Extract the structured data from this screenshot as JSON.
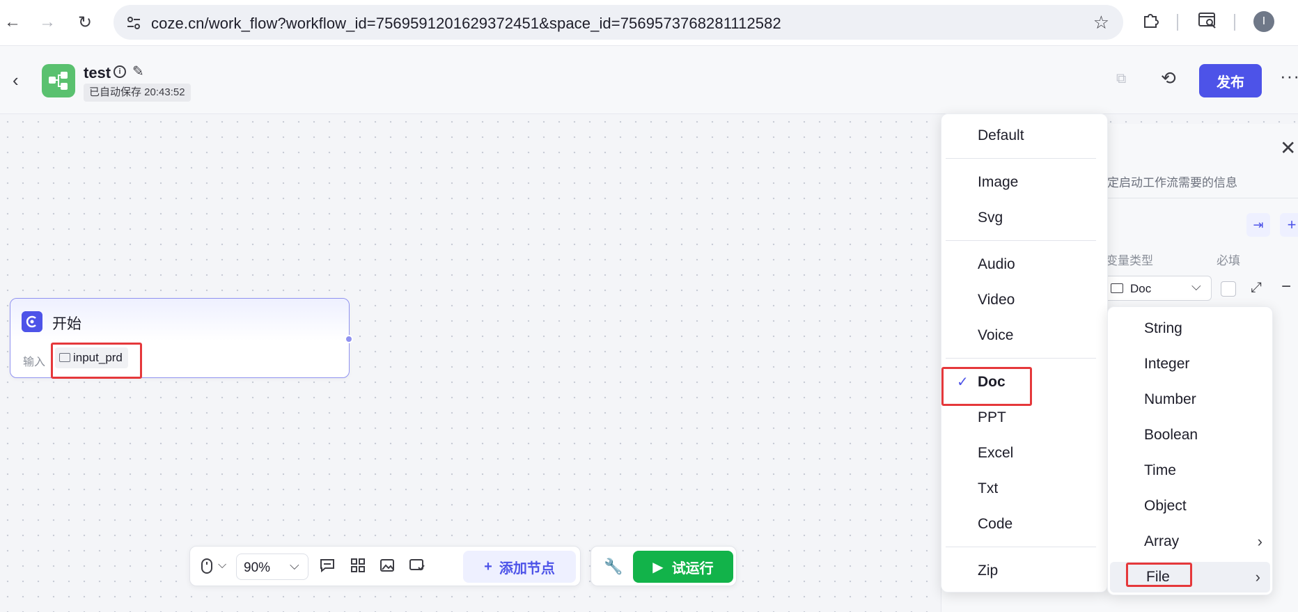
{
  "browser": {
    "url": "coze.cn/work_flow?workflow_id=7569591201629372451&space_id=7569573768281112582",
    "back": "←",
    "forward": "→",
    "reload": "↻",
    "star": "☆",
    "profile_initial": "I",
    "extensions_icon": "puzzle-icon",
    "tab_search_icon": "tab-search-icon"
  },
  "header": {
    "back": "‹",
    "title": "test",
    "autosave": "已自动保存 20:43:52",
    "publish_label": "发布",
    "more": "···"
  },
  "start_node": {
    "title": "开始",
    "input_label": "输入",
    "input_name": "input_prd"
  },
  "toolbar": {
    "zoom": "90%",
    "add_node_label": "添加节点",
    "test_run_label": "试运行"
  },
  "panel": {
    "desc": "定启动工作流需要的信息",
    "col_type": "变量类型",
    "col_required": "必填",
    "type_value": "Doc"
  },
  "file_menu": {
    "items": [
      "Default",
      "Image",
      "Svg",
      "Audio",
      "Video",
      "Voice",
      "Doc",
      "PPT",
      "Excel",
      "Txt",
      "Code",
      "Zip"
    ],
    "selected": "Doc"
  },
  "type_menu": {
    "items": [
      "String",
      "Integer",
      "Number",
      "Boolean",
      "Time",
      "Object",
      "Array",
      "File"
    ],
    "selected": "File"
  },
  "colors": {
    "accent": "#4d53e8",
    "green": "#12b34a",
    "highlight_red": "#e5383b",
    "logo_green": "#5ac16f"
  }
}
